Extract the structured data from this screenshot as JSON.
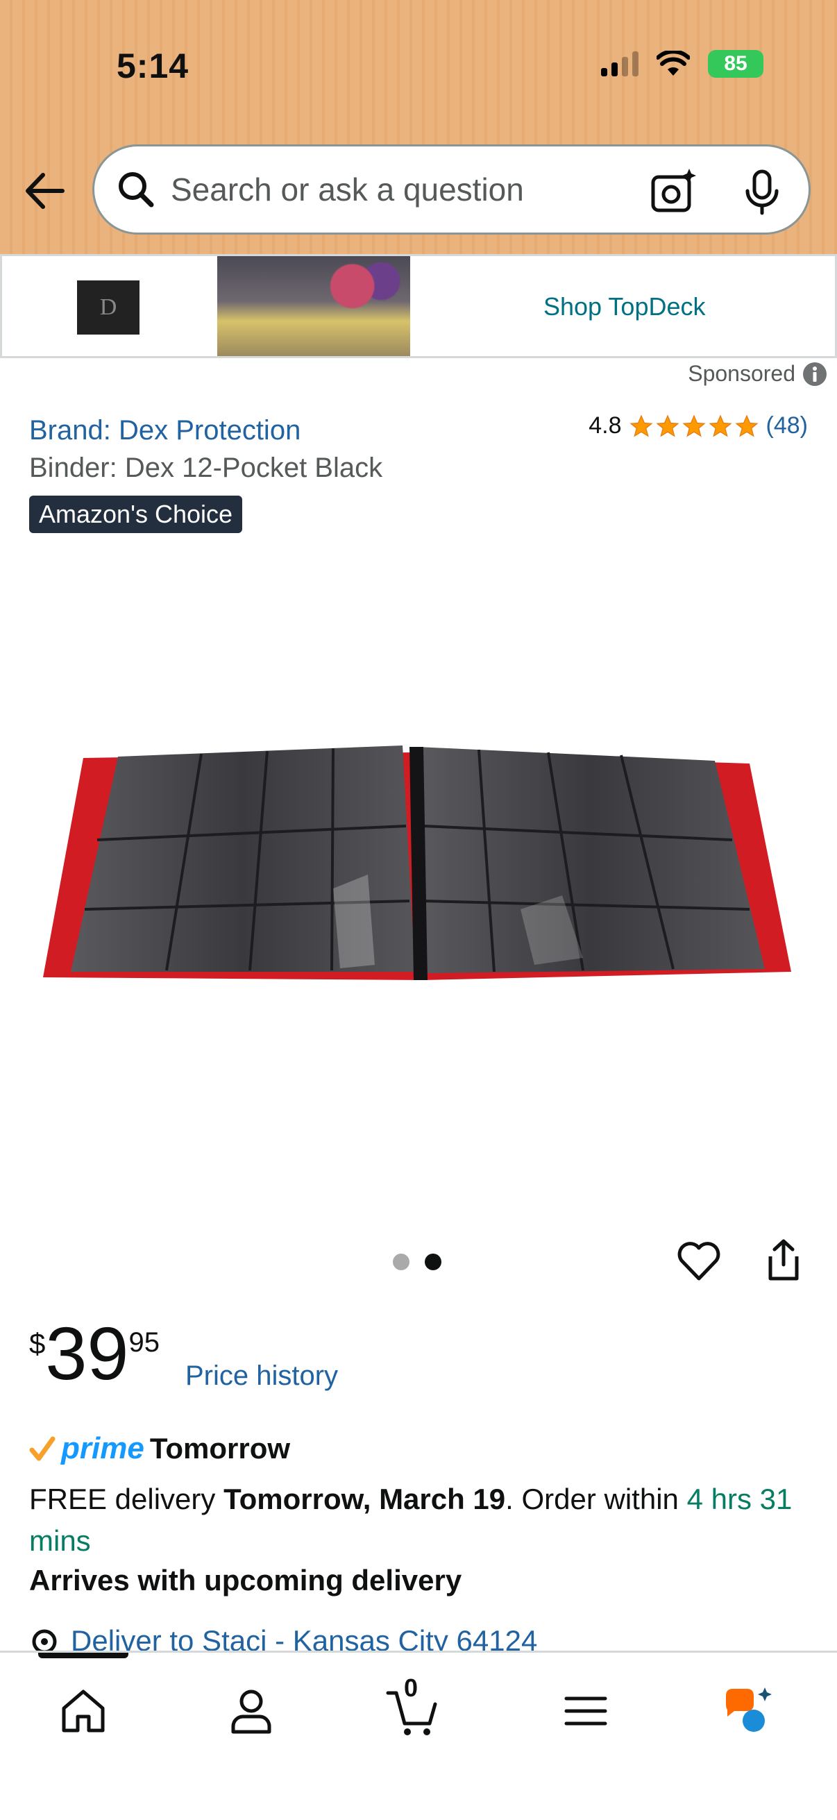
{
  "status_bar": {
    "time": "5:14",
    "battery": "85"
  },
  "search": {
    "placeholder": "Search or ask a question"
  },
  "banner": {
    "logo_text": "D",
    "link_label": "Shop TopDeck",
    "sponsored_label": "Sponsored"
  },
  "product": {
    "brand": "Brand: Dex Protection",
    "title": "Binder: Dex 12-Pocket Black",
    "badge": "Amazon's Choice",
    "rating": "4.8",
    "rating_count": "(48)",
    "rating_stars": 4.8,
    "image_count": 2,
    "active_image": 2
  },
  "price": {
    "symbol": "$",
    "whole": "39",
    "fraction": "95",
    "history_label": "Price history"
  },
  "delivery": {
    "prime_label": "prime",
    "prime_day": "Tomorrow",
    "free_text": "FREE delivery ",
    "date": "Tomorrow, March 19",
    "order_within": ". Order within ",
    "countdown": "4 hrs 31 mins",
    "arrives": "Arrives with upcoming delivery",
    "deliver_to": "Deliver to Staci - Kansas City 64124"
  },
  "nav": {
    "cart_count": "0"
  },
  "colors": {
    "header": "#eab27c",
    "link": "#2162a1",
    "teal_link": "#007185",
    "green": "#067d62",
    "star": "#ff9900",
    "prime": "#1399ff"
  }
}
